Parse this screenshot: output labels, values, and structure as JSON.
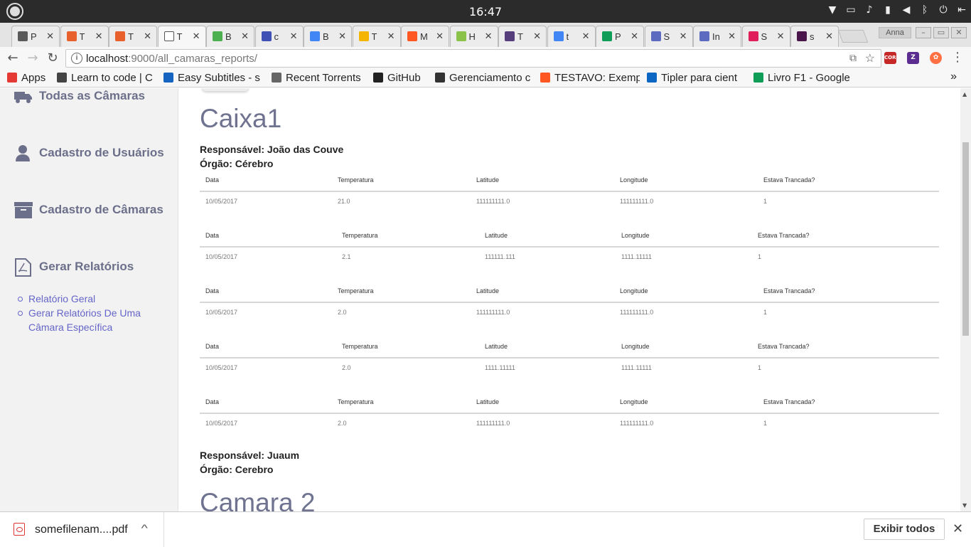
{
  "os": {
    "clock": "16:47"
  },
  "tabs": [
    {
      "title": "P",
      "color": "#5a5a5a"
    },
    {
      "title": "T",
      "color": "#e8612c"
    },
    {
      "title": "T",
      "color": "#e8612c"
    },
    {
      "title": "T",
      "color": "#ffffff"
    },
    {
      "title": "B",
      "color": "#4caf50"
    },
    {
      "title": "c",
      "color": "#3f51b5"
    },
    {
      "title": "B",
      "color": "#4285f4"
    },
    {
      "title": "T",
      "color": "#f4b400"
    },
    {
      "title": "M",
      "color": "#ff5722"
    },
    {
      "title": "H",
      "color": "#8bc34a"
    },
    {
      "title": "T",
      "color": "#563d7c"
    },
    {
      "title": "t",
      "color": "#4285f4"
    },
    {
      "title": "P",
      "color": "#0f9d58"
    },
    {
      "title": "S",
      "color": "#5c6bc0"
    },
    {
      "title": "In",
      "color": "#5c6bc0"
    },
    {
      "title": "S",
      "color": "#e01e5a"
    },
    {
      "title": "s",
      "color": "#4a154b"
    }
  ],
  "profile": "Anna",
  "address": {
    "host": "localhost",
    "rest": ":9000/all_camaras_reports/"
  },
  "bookmarks": [
    {
      "label": "Apps",
      "color": "#e53935"
    },
    {
      "label": "Learn to code | C",
      "color": "#444444"
    },
    {
      "label": "Easy Subtitles - s",
      "color": "#1565c0"
    },
    {
      "label": "Recent Torrents",
      "color": "#666666"
    },
    {
      "label": "GitHub",
      "color": "#222222"
    },
    {
      "label": "Gerenciamento c",
      "color": "#333333"
    },
    {
      "label": "TESTAVO: Exemp",
      "color": "#ff5722"
    },
    {
      "label": "Tipler para cient",
      "color": "#0a66c2"
    },
    {
      "label": "Livro F1 - Google",
      "color": "#0f9d58"
    }
  ],
  "sidebar": {
    "items": [
      {
        "label": "Todas as Câmaras",
        "icon": "truck-icon"
      },
      {
        "label": "Cadastro de Usuários",
        "icon": "user-icon"
      },
      {
        "label": "Cadastro de Câmaras",
        "icon": "archive-icon"
      },
      {
        "label": "Gerar Relatórios",
        "icon": "pdf-file-icon"
      }
    ],
    "links": [
      "Relatório Geral",
      "Gerar Relatórios De Uma Câmara Específica"
    ]
  },
  "report": {
    "camera1": {
      "title": "Caixa1",
      "responsavel": "Responsável: João das Couve",
      "orgao": "Órgão: Cérebro"
    },
    "headers": [
      "Data",
      "Temperatura",
      "Latitude",
      "Longitude",
      "Estava Trancada?"
    ],
    "rows": [
      [
        "10/05/2017",
        "21.0",
        "111111111.0",
        "111111111.0",
        "1"
      ],
      [
        "10/05/2017",
        "2.1",
        "111111.111",
        "1111.11111",
        "1"
      ],
      [
        "10/05/2017",
        "2.0",
        "111111111.0",
        "111111111.0",
        "1"
      ],
      [
        "10/05/2017",
        "2.0",
        "1111.11111",
        "1111.11111",
        "1"
      ],
      [
        "10/05/2017",
        "2.0",
        "111111111.0",
        "111111111.0",
        "1"
      ]
    ],
    "camera2": {
      "title": "Camara 2",
      "responsavel": "Responsável: Juaum",
      "orgao": "Órgão: Cerebro"
    }
  },
  "download": {
    "filename": "somefilenam....pdf",
    "show_all": "Exibir todos"
  }
}
